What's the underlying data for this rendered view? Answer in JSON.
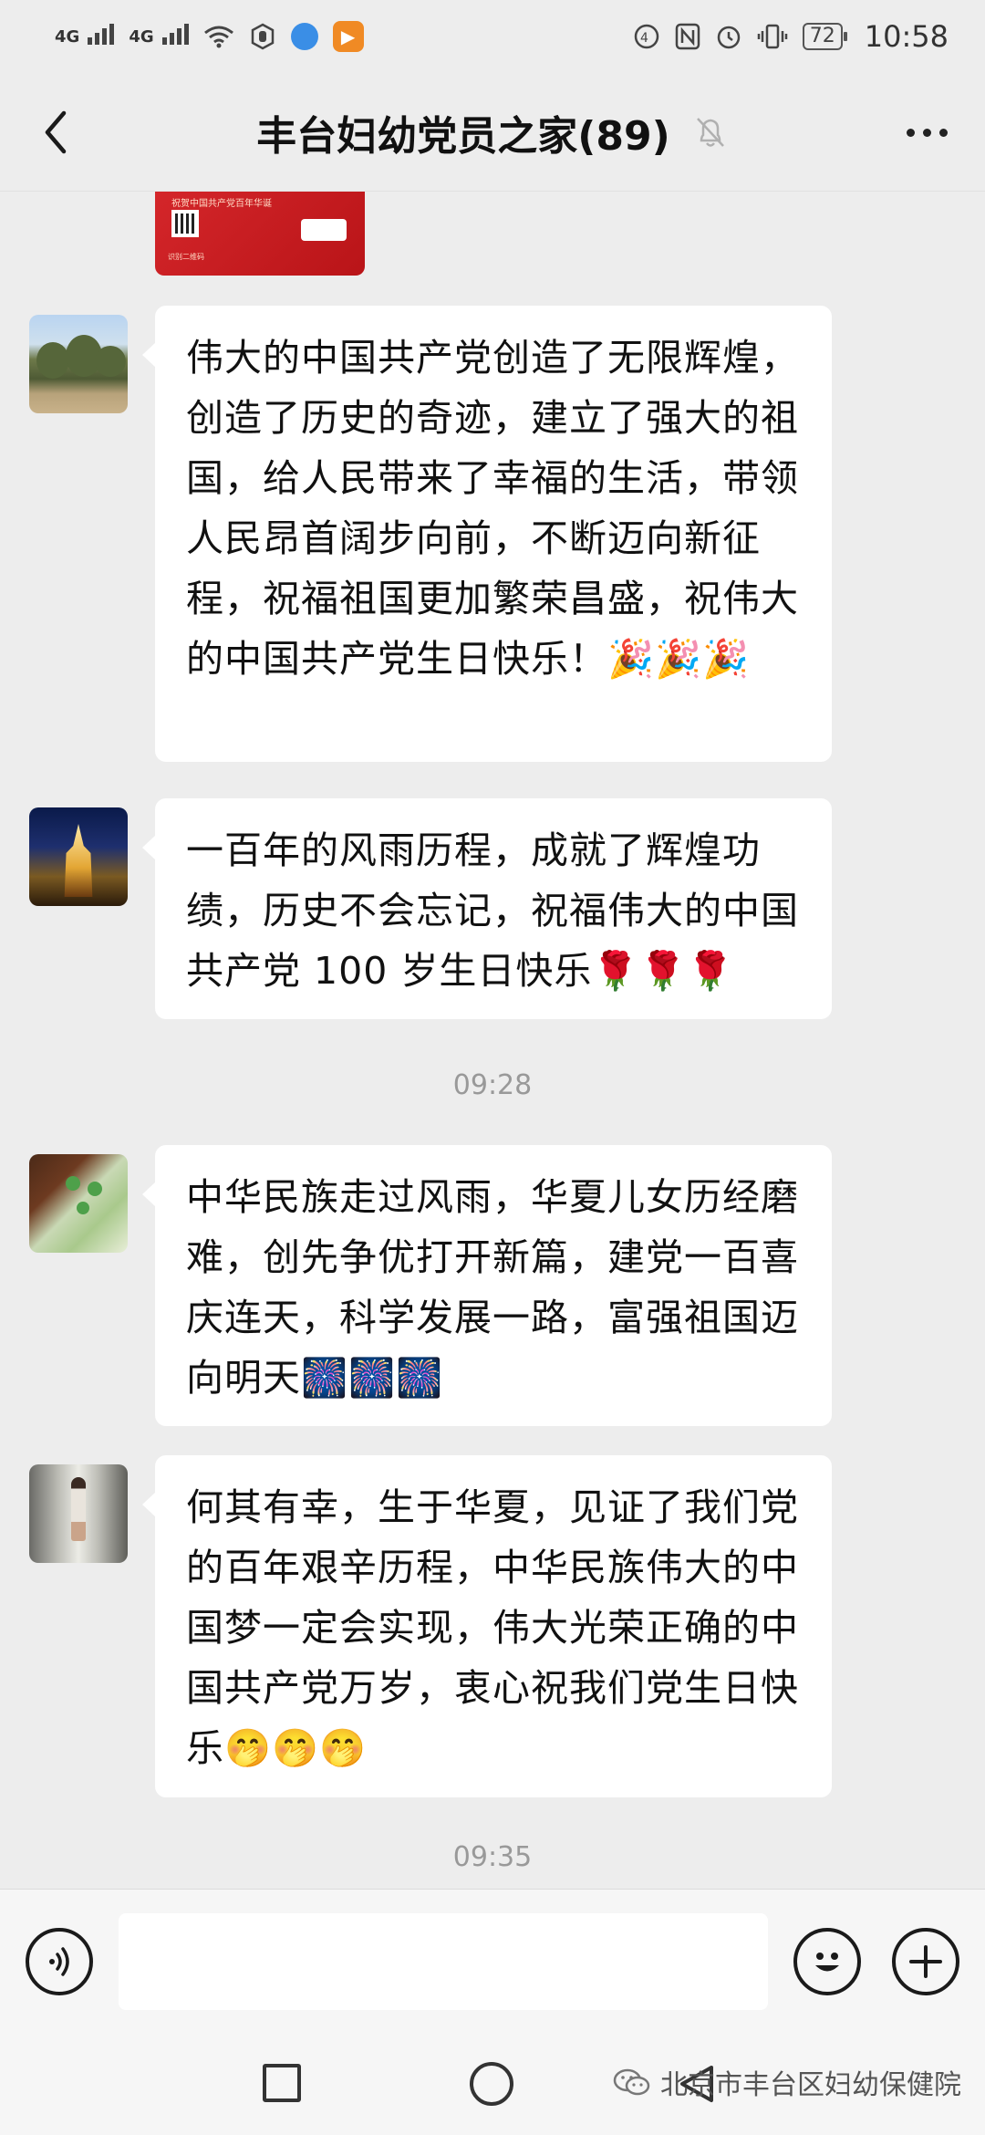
{
  "status_bar": {
    "signal1": "4G",
    "signal2": "4G",
    "battery": "72",
    "time": "10:58"
  },
  "header": {
    "title": "丰台妇幼党员之家(89)"
  },
  "card": {
    "text": "祝贺中国共产党百年华诞",
    "sub": "识别二维码"
  },
  "messages": [
    {
      "text": "伟大的中国共产党创造了无限辉煌，创造了历史的奇迹，建立了强大的祖国，给人民带来了幸福的生活，带领人民昂首阔步向前，不断迈向新征程，祝福祖国更加繁荣昌盛，祝伟大的中国共产党生日快乐！🎉🎉🎉"
    },
    {
      "text": "一百年的风雨历程，成就了辉煌功绩，历史不会忘记，祝福伟大的中国共产党 100 岁生日快乐🌹🌹🌹"
    },
    {
      "text": "中华民族走过风雨，华夏儿女历经磨难，创先争优打开新篇，建党一百喜庆连天，科学发展一路，富强祖国迈向明天🎆🎆🎆"
    },
    {
      "text": "何其有幸，生于华夏，见证了我们党的百年艰辛历程，中华民族伟大的中国梦一定会实现，伟大光荣正确的中国共产党万岁，衷心祝我们党生日快乐🤭🤭🤭"
    }
  ],
  "timestamps": [
    "09:28",
    "09:35"
  ],
  "input": {
    "value": ""
  },
  "watermark": {
    "text": "北京市丰台区妇幼保健院"
  },
  "icons": {
    "back": "chevron-left-icon",
    "mute": "bell-off-icon",
    "more": "more-dots-icon",
    "voice": "voice-icon",
    "emoji": "smile-icon",
    "plus": "plus-icon"
  }
}
